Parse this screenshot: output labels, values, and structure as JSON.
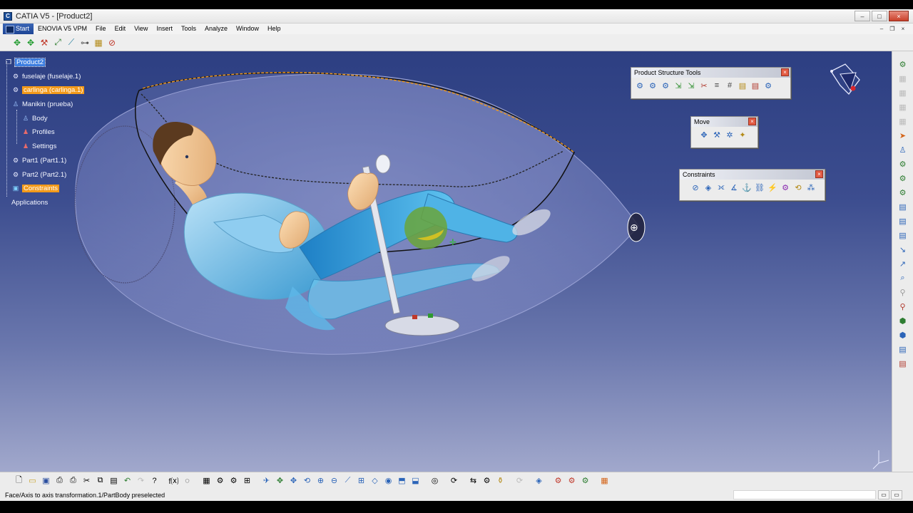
{
  "window": {
    "title": "CATIA V5 - [Product2]",
    "controls": {
      "minimize": "–",
      "maximize": "□",
      "close": "×"
    }
  },
  "menubar": {
    "items": [
      "Start",
      "ENOVIA V5 VPM",
      "File",
      "Edit",
      "View",
      "Insert",
      "Tools",
      "Analyze",
      "Window",
      "Help"
    ]
  },
  "tree": {
    "nodes": [
      {
        "label": "Product2",
        "icon": "product-icon",
        "state": "selected"
      },
      {
        "label": "fuselaje (fuselaje.1)",
        "icon": "part-icon",
        "state": "normal"
      },
      {
        "label": "carlinga (carlinga.1)",
        "icon": "part-icon",
        "state": "highlighted"
      },
      {
        "label": "Manikin (prueba)",
        "icon": "manikin-icon",
        "state": "normal"
      },
      {
        "label": "Body",
        "icon": "body-icon",
        "state": "normal"
      },
      {
        "label": "Profiles",
        "icon": "profiles-icon",
        "state": "normal"
      },
      {
        "label": "Settings",
        "icon": "settings-icon",
        "state": "normal"
      },
      {
        "label": "Part1 (Part1.1)",
        "icon": "part-icon",
        "state": "normal"
      },
      {
        "label": "Part2 (Part2.1)",
        "icon": "part-icon",
        "state": "normal"
      },
      {
        "label": "Constraints",
        "icon": "constraints-icon",
        "state": "highlighted"
      },
      {
        "label": "Applications",
        "icon": "",
        "state": "normal"
      }
    ]
  },
  "panels": {
    "product_structure": {
      "title": "Product Structure Tools",
      "close": "×",
      "icon_count": 11
    },
    "move": {
      "title": "Move",
      "close": "×",
      "icon_count": 4
    },
    "constraints": {
      "title": "Constraints",
      "close": "×",
      "icon_count": 10
    }
  },
  "status": {
    "message": "Face/Axis to axis transformation.1/PartBody preselected"
  },
  "colors": {
    "viewport_top": "#2d3f82",
    "viewport_bottom": "#a1a8cc",
    "selection": "#3d7ee0",
    "highlight": "#f39a1a",
    "manikin_skin": "#f4c994",
    "manikin_clothes": "#62b8e6"
  }
}
